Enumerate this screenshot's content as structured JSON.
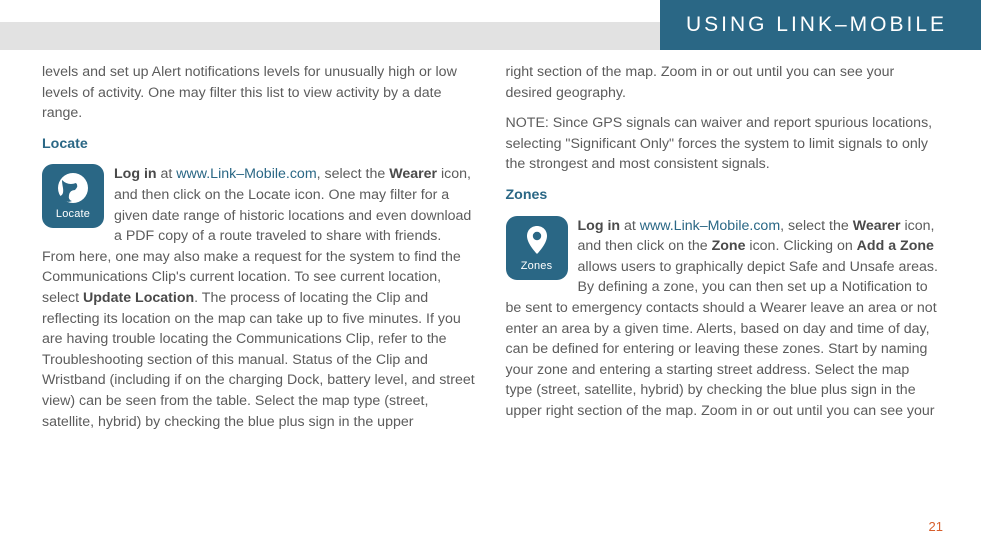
{
  "header": {
    "title": "USING LINK–MOBILE"
  },
  "col1": {
    "intro": "levels and set up Alert notifications levels for unusually high or low levels of activity. One may filter this list to view activity by a date range.",
    "locate_heading": "Locate",
    "locate_icon_label": "Locate",
    "locate_p1a": "Log in",
    "locate_p1b": " at ",
    "locate_p1_link": "www.Link–Mobile.com",
    "locate_p1c": ", select the ",
    "locate_p1d": "Wearer",
    "locate_p1e": " icon, and then click on the Locate icon. One may filter for a given date range of historic locations and even download a PDF copy of a route traveled to share with friends. From here, one may also make a request for the system to find the Communications Clip's current location. To see current location, select ",
    "locate_p1f": "Update Location",
    "locate_p1g": ". The process of locating the Clip and reflecting its location on the map can take up to five minutes. If you are having trouble locating the Communications Clip, refer to the Troubleshooting section of this manual. Status of the Clip and Wristband (including if on the charging Dock, battery level, and street view) can be seen from the table. Select the map type (street, satellite, hybrid) by checking the blue plus sign in the upper"
  },
  "col2": {
    "p1": "right section of the map. Zoom in or out until you can see your desired geography.",
    "p2": "NOTE: Since GPS signals can waiver and report spurious locations, selecting \"Significant Only\" forces the system to limit signals to only the strongest and most consistent signals.",
    "zones_heading": "Zones",
    "zones_icon_label": "Zones",
    "zones_p1a": "Log in",
    "zones_p1b": " at ",
    "zones_p1_link": "www.Link–Mobile.com",
    "zones_p1c": ", select the ",
    "zones_p1d": "Wearer",
    "zones_p1e": " icon, and then click on the ",
    "zones_p1f": "Zone",
    "zones_p1g": " icon. Clicking on ",
    "zones_p1h": "Add a Zone",
    "zones_p1i": " allows users to graphically depict Safe and Unsafe areas. By defining a zone, you can then set up a Notification to be sent to emergency contacts should a Wearer leave an area or not enter an area by a given time. Alerts, based on day and time of day, can be defined for entering or leaving these zones. Start by naming your zone and entering a starting street address. Select the map type (street, satellite, hybrid) by checking the blue plus sign in the upper right section of the map. Zoom in or out until you can see your"
  },
  "page_number": "21"
}
